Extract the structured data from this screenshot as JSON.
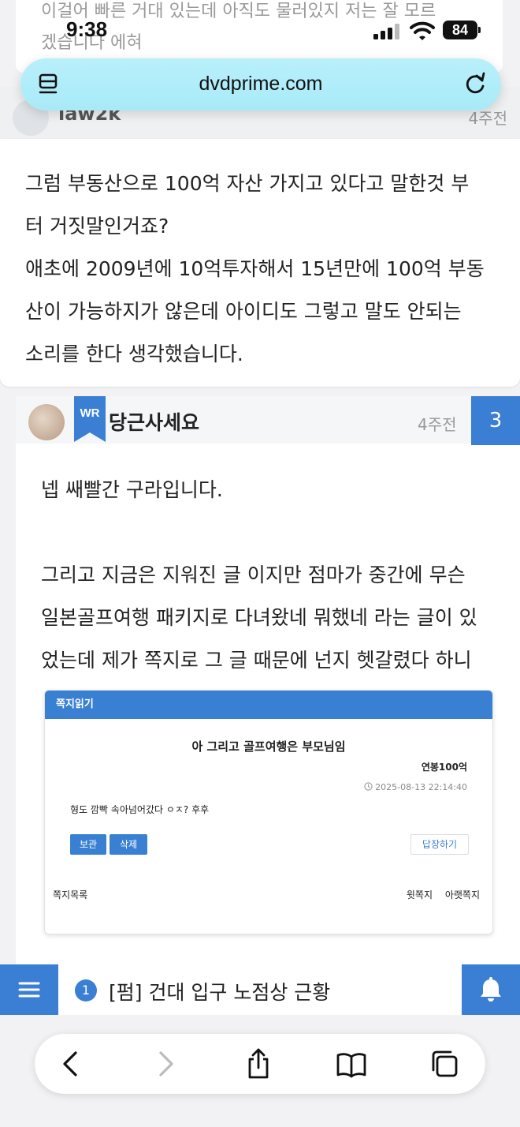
{
  "background_comment": {
    "line1": "이걸어 빠른 거대 있는데 아직도 물러있지 저는 잘 모르",
    "line2": "겠습니다 에혀"
  },
  "status_bar": {
    "time": "9:38",
    "battery": "84"
  },
  "browser": {
    "url": "dvdprime.com"
  },
  "comment1": {
    "author": "law2k",
    "time": "4주전",
    "lines": [
      "그럼 부동산으로 100억 자산 가지고 있다고 말한것 부",
      "터 거짓말인거죠?",
      "애초에 2009년에 10억투자해서 15년만에 100억 부동",
      "산이 가능하지가 않은데 아이디도 그렇고 말도 안되는",
      "소리를 한다 생각했습니다."
    ]
  },
  "comment2": {
    "badge": "WR",
    "author": "당근사세요",
    "time": "4주전",
    "number": "3",
    "lines": [
      "넵 쌔빨간 구라입니다.",
      "그리고 지금은 지워진 글 이지만 점마가 중간에 무슨",
      "일본골프여행 패키지로 다녀왔네 뭐했네 라는 글이 있",
      "었는데 제가 쪽지로 그 글 때문에 넌지 헷갈렸다 하니"
    ],
    "message_screenshot": {
      "title": "쪽지읽기",
      "subject": "아 그리고 골프여행은 부모님임",
      "sender": "연봉100억",
      "date": "2025-08-13 22:14:40",
      "body": "형도 깜빡 속아넘어갔다 ㅇㅈ? 후후",
      "keep_label": "보관",
      "delete_label": "삭제",
      "reply_label": "답장하기",
      "list_label": "쪽지목록",
      "prev_label": "윗쪽지",
      "next_label": "아랫쪽지"
    }
  },
  "notice_bar": {
    "badge": "1",
    "text": "[펌] 건대 입구 노점상 근황"
  },
  "colors": {
    "accent": "#3a7fd3",
    "url_bar": "#aeecf9"
  }
}
